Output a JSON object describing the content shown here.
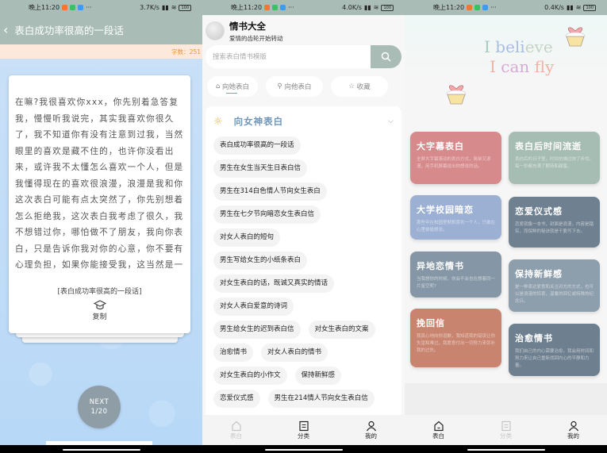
{
  "status_bars": [
    {
      "time": "晚上11:20",
      "dots": "···",
      "speed": "3.7K/s",
      "battery": "100"
    },
    {
      "time": "晚上11:20",
      "dots": "···",
      "speed": "4.0K/s",
      "battery": "100"
    },
    {
      "time": "晚上11:20",
      "dots": "···",
      "speed": "0.4K/s",
      "battery": "100"
    }
  ],
  "detail": {
    "back_glyph": "‹",
    "title": "表白成功率很高的一段话",
    "word_count": "字数：251",
    "body": "在嘛?我很喜欢你xxx，你先别着急答复我，慢慢听我说完，其实我喜欢你很久了，我不知道你有没有注意到过我，当然眼里的喜欢是藏不住的，也许你没看出来，或许我不太懂怎么喜欢一个人，但是我懂得现在的喜欢很浪漫，浪漫是我和你这次表白可能有点太突然了，你先别想着怎么拒绝我，这次表白我考虑了很久，我不想错过你，哪怕做不了朋友，我向你表白，只是告诉你我对你的心意，你不要有心理负担，如果你能接受我，这当然是一件很开心的事情，如果你拒绝了我，我也会坦然的接受，毕竟每个人都会有喜欢的那个你考虑考虑吧，我等待你的回复",
    "source_title": "[表白成功率很高的一段话]",
    "copy_label": "复制",
    "next_label": "NEXT",
    "page_indicator": "1/20"
  },
  "category": {
    "app_title": "情书大全",
    "app_subtitle": "爱情的齿轮开始转动",
    "search_placeholder": "搜索表白情书模版",
    "tabs": [
      {
        "icon": "⌂",
        "label": "向她表白",
        "active": true
      },
      {
        "icon": "⚲",
        "label": "向他表白",
        "active": false
      },
      {
        "icon": "☆",
        "label": "收藏",
        "active": false
      }
    ],
    "section_title": "向女神表白",
    "chips": [
      "表白成功率很高的一段话",
      "男生在女生当天生日表白信",
      "男生在314白色情人节向女生表白",
      "男生在七夕节向暗恋女生表白信",
      "对女人表白的短句",
      "男生写给女生的小纸条表白",
      "对女生表白的话，既诚又真实的情话",
      "对女人表白爱意的诗词",
      "男生给女生的迟到表白信",
      "对女生表白的文案",
      "治愈情书",
      "对女人表白的情书",
      "对女生表白的小作文",
      "保持新鲜感",
      "恋爱仪式感",
      "男生在214情人节向女生表白信"
    ]
  },
  "home": {
    "banner_line1": [
      "I ",
      "beli",
      "eve"
    ],
    "banner_line2": [
      "I ",
      "can",
      " fly"
    ],
    "cards": [
      {
        "title": "大字幕表白",
        "desc": "全屏大字幕滚动的表白方式，简单又浪漫，用手机屏幕说出你想说的话。",
        "color": "#d78a8c"
      },
      {
        "title": "表白后时间流逝",
        "desc": "表白后的日子里，时间仿佛过快了步伐，每一秒都充满了期待和甜蜜。",
        "color": "#a6bdb4"
      },
      {
        "title": "大学校园暗恋",
        "desc": "那些年在校园里默默喜欢一个人，只敢在心里偷偷想念。",
        "color": "#9cb0d4"
      },
      {
        "title": "恋爱仪式感",
        "desc": "恋爱就像一本书，封面是浪漫，内容是踏实，而保鲜的秘诀就是干脆写下去。",
        "color": "#6f8191"
      },
      {
        "title": "异地恋情书",
        "desc": "当我想你的时候，你会不会也在想着同一片星空呢?",
        "color": "#8597a6"
      },
      {
        "title": "保持新鲜感",
        "desc": "是一种表达爱意和关注对方的方式，也可以是浪漫的惊喜，温馨的回忆或特殊的纪念日。",
        "color": "#8d9eac"
      },
      {
        "title": "挽回信",
        "desc": "我真心地向你道歉，我知道我的错误让你失望和难过，我愿意付出一切努力来弥补我的过失。",
        "color": "#c9846f"
      },
      {
        "title": "治愈情书",
        "desc": "我们自己的内心需要治愈，我会用时间和努力来让自己重新找回内心的平静和力量。",
        "color": "#6e8090"
      }
    ]
  },
  "tabbar": {
    "items": [
      {
        "label": "表白"
      },
      {
        "label": "分类"
      },
      {
        "label": "我的"
      }
    ]
  }
}
